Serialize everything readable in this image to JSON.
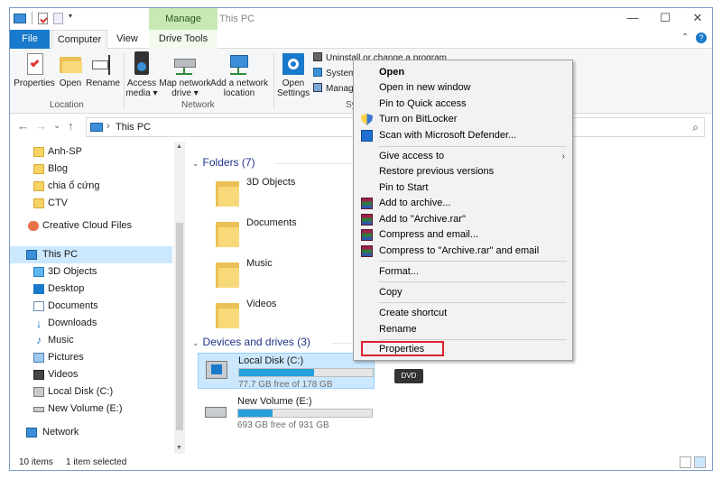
{
  "window": {
    "title": "This PC",
    "manage_tab": "Manage",
    "controls": {
      "minimize": "—",
      "maximize": "☐",
      "close": "✕"
    }
  },
  "ribbon_tabs": {
    "file": "File",
    "computer": "Computer",
    "view": "View",
    "drive_tools": "Drive Tools"
  },
  "ribbon": {
    "location_group": {
      "label": "Location",
      "buttons": [
        "Properties",
        "Open",
        "Rename"
      ]
    },
    "network_group": {
      "label": "Network",
      "access_media": [
        "Access",
        "media ▾"
      ],
      "map_network_drive": [
        "Map network",
        "drive ▾"
      ],
      "add_network_location": [
        "Add a network",
        "location"
      ]
    },
    "system_group": {
      "label": "Sy",
      "open_settings": [
        "Open",
        "Settings"
      ],
      "uninstall": "Uninstall or change a program",
      "system": "System",
      "manage": "Manage"
    }
  },
  "address": {
    "path": "This PC",
    "back": "←",
    "forward": "→",
    "recent": "⌄",
    "up": "↑",
    "separator": "›",
    "search_icon": "⌕"
  },
  "nav_pane": {
    "items": [
      {
        "label": "Anh-SP",
        "icon": "folder-icon"
      },
      {
        "label": "Blog",
        "icon": "folder-icon"
      },
      {
        "label": "chia ổ cứng",
        "icon": "folder-icon"
      },
      {
        "label": "CTV",
        "icon": "folder-icon"
      },
      {
        "label": "Creative Cloud Files",
        "icon": "creative-cloud-icon"
      },
      {
        "label": "This PC",
        "icon": "computer-icon"
      },
      {
        "label": "3D Objects",
        "icon": "3d-objects-icon"
      },
      {
        "label": "Desktop",
        "icon": "desktop-icon"
      },
      {
        "label": "Documents",
        "icon": "documents-icon"
      },
      {
        "label": "Downloads",
        "icon": "downloads-icon"
      },
      {
        "label": "Music",
        "icon": "music-icon"
      },
      {
        "label": "Pictures",
        "icon": "pictures-icon"
      },
      {
        "label": "Videos",
        "icon": "videos-icon"
      },
      {
        "label": "Local Disk (C:)",
        "icon": "drive-icon"
      },
      {
        "label": "New Volume (E:)",
        "icon": "drive-icon"
      },
      {
        "label": "Network",
        "icon": "network-icon"
      }
    ],
    "selected": "This PC"
  },
  "content": {
    "folders_header": "Folders (7)",
    "folders": [
      "3D Objects",
      "Documents",
      "Music",
      "Videos"
    ],
    "devices_header": "Devices and drives (3)",
    "drives": [
      {
        "name": "Local Disk (C:)",
        "free": "77.7 GB free of 178 GB",
        "used_fraction": 0.56,
        "selected": true
      },
      {
        "name": "New Volume (E:)",
        "free": "693 GB free of 931 GB",
        "used_fraction": 0.26,
        "selected": false
      }
    ],
    "dvd_label": "DVD"
  },
  "status": {
    "items": "10 items",
    "selected": "1 item selected"
  },
  "context_menu": {
    "items": [
      {
        "label": "Open",
        "bold": true
      },
      {
        "label": "Open in new window"
      },
      {
        "label": "Pin to Quick access"
      },
      {
        "label": "Turn on BitLocker",
        "icon": "shield-icon"
      },
      {
        "label": "Scan with Microsoft Defender...",
        "icon": "defender-icon"
      },
      {
        "label": "Give access to",
        "submenu": "›"
      },
      {
        "label": "Restore previous versions"
      },
      {
        "label": "Pin to Start"
      },
      {
        "label": "Add to archive...",
        "icon": "winrar-icon"
      },
      {
        "label": "Add to \"Archive.rar\"",
        "icon": "winrar-icon"
      },
      {
        "label": "Compress and email...",
        "icon": "winrar-icon"
      },
      {
        "label": "Compress to \"Archive.rar\" and email",
        "icon": "winrar-icon"
      },
      {
        "label": "Format..."
      },
      {
        "label": "Copy"
      },
      {
        "label": "Create shortcut"
      },
      {
        "label": "Rename"
      },
      {
        "label": "Properties",
        "highlighted": true
      }
    ],
    "highlight_color": "#d9232c"
  },
  "colors": {
    "accent": "#1979ca",
    "manage_tab": "#c8e9b4",
    "selection": "#cce8ff",
    "drive_fill": "#26a0da",
    "section_header": "#1e3287"
  }
}
